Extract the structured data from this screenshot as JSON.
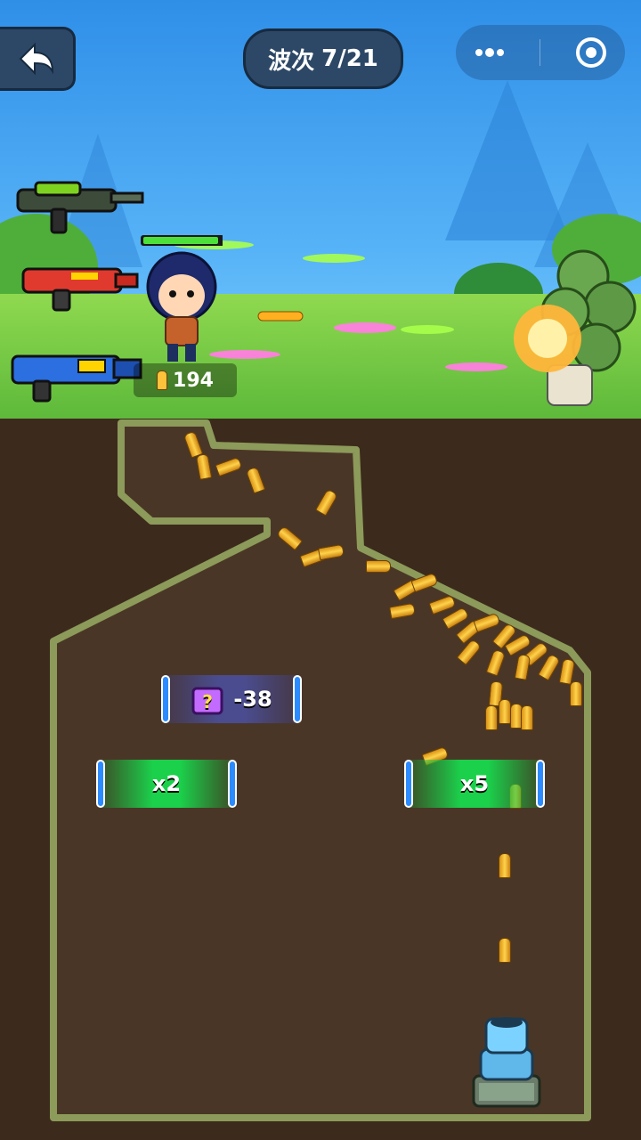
{
  "hud": {
    "back_icon": "back-arrow-icon",
    "wave_label": "波次",
    "wave_value": "7/21",
    "menu_icon": "more-dots-icon",
    "close_icon": "target-circle-icon"
  },
  "player": {
    "ammo_count": "194",
    "ammo_icon": "bullet-icon"
  },
  "weapons": [
    {
      "name": "green-blaster-icon"
    },
    {
      "name": "red-rifle-icon"
    },
    {
      "name": "blue-launcher-icon"
    }
  ],
  "gates": [
    {
      "label": "-38",
      "icon": "mystery-box-icon",
      "type": "purple"
    },
    {
      "label": "x2",
      "type": "green"
    },
    {
      "label": "x5",
      "type": "green"
    }
  ],
  "colors": {
    "sky": "#3c9df0",
    "grass": "#6cc646",
    "dirt": "#3c2a1c",
    "channel": "#4a3626",
    "channel_border": "#8c9a5a",
    "gate_green": "#1bd14b",
    "gate_purple": "#4a4c8f",
    "hud_panel": "#2d4866"
  }
}
